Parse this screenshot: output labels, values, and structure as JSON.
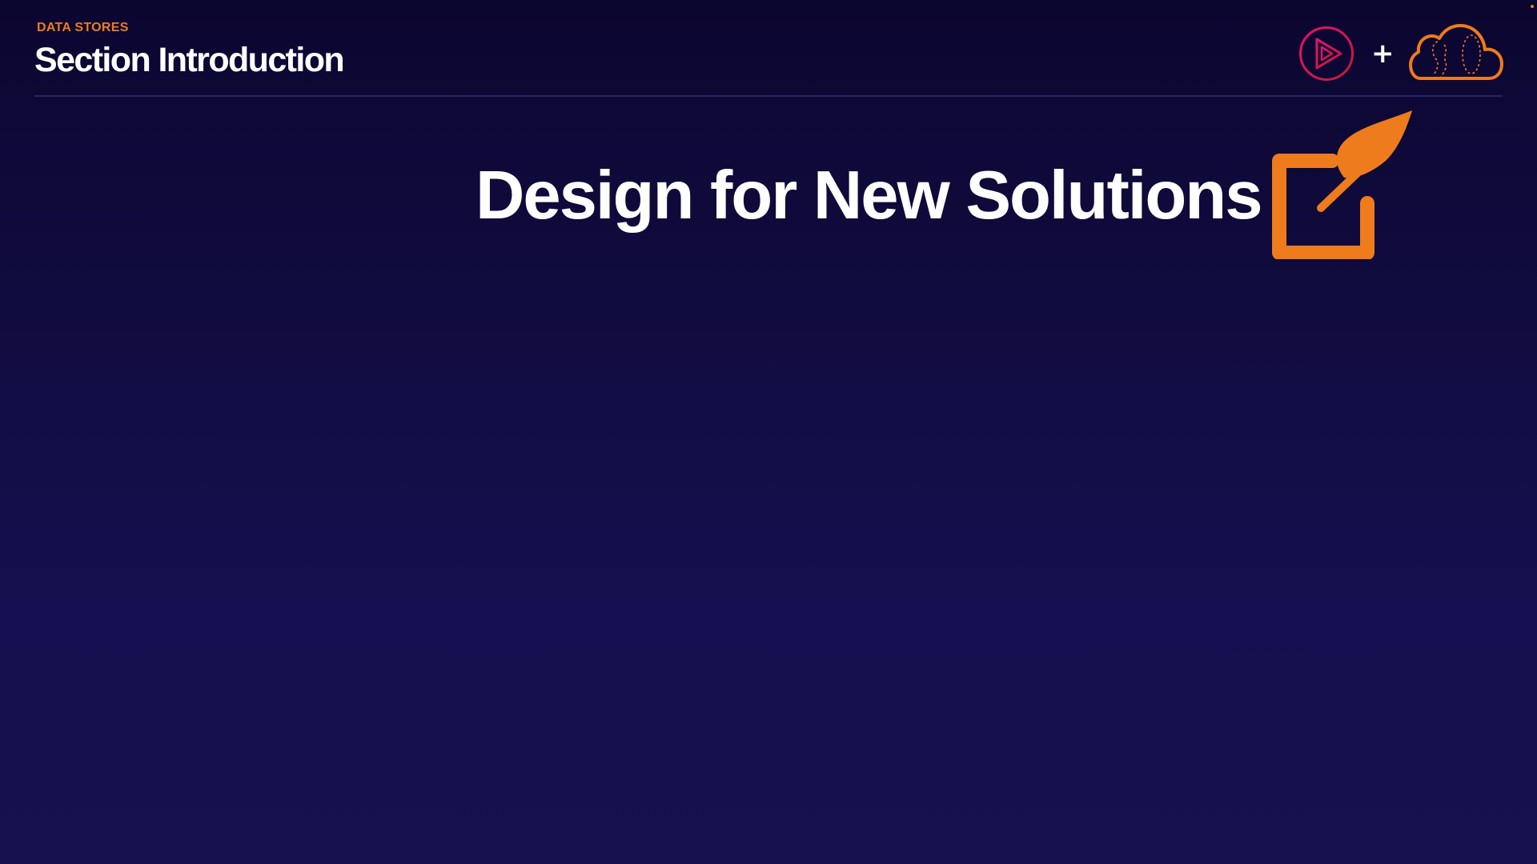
{
  "header": {
    "eyebrow": "DATA STORES",
    "title": "Section Introduction",
    "plus": "+"
  },
  "slide": {
    "title": "Design for New Solutions"
  },
  "icons": {
    "brand_logo": "play-circle-icon",
    "partner_logo": "cloud-icon",
    "slide_icon": "edit-feather-icon"
  },
  "colors": {
    "accent_orange": "#ee7b1c",
    "brand_pink": "#e4136b",
    "brand_red": "#c3183a",
    "background": "#130d45"
  }
}
